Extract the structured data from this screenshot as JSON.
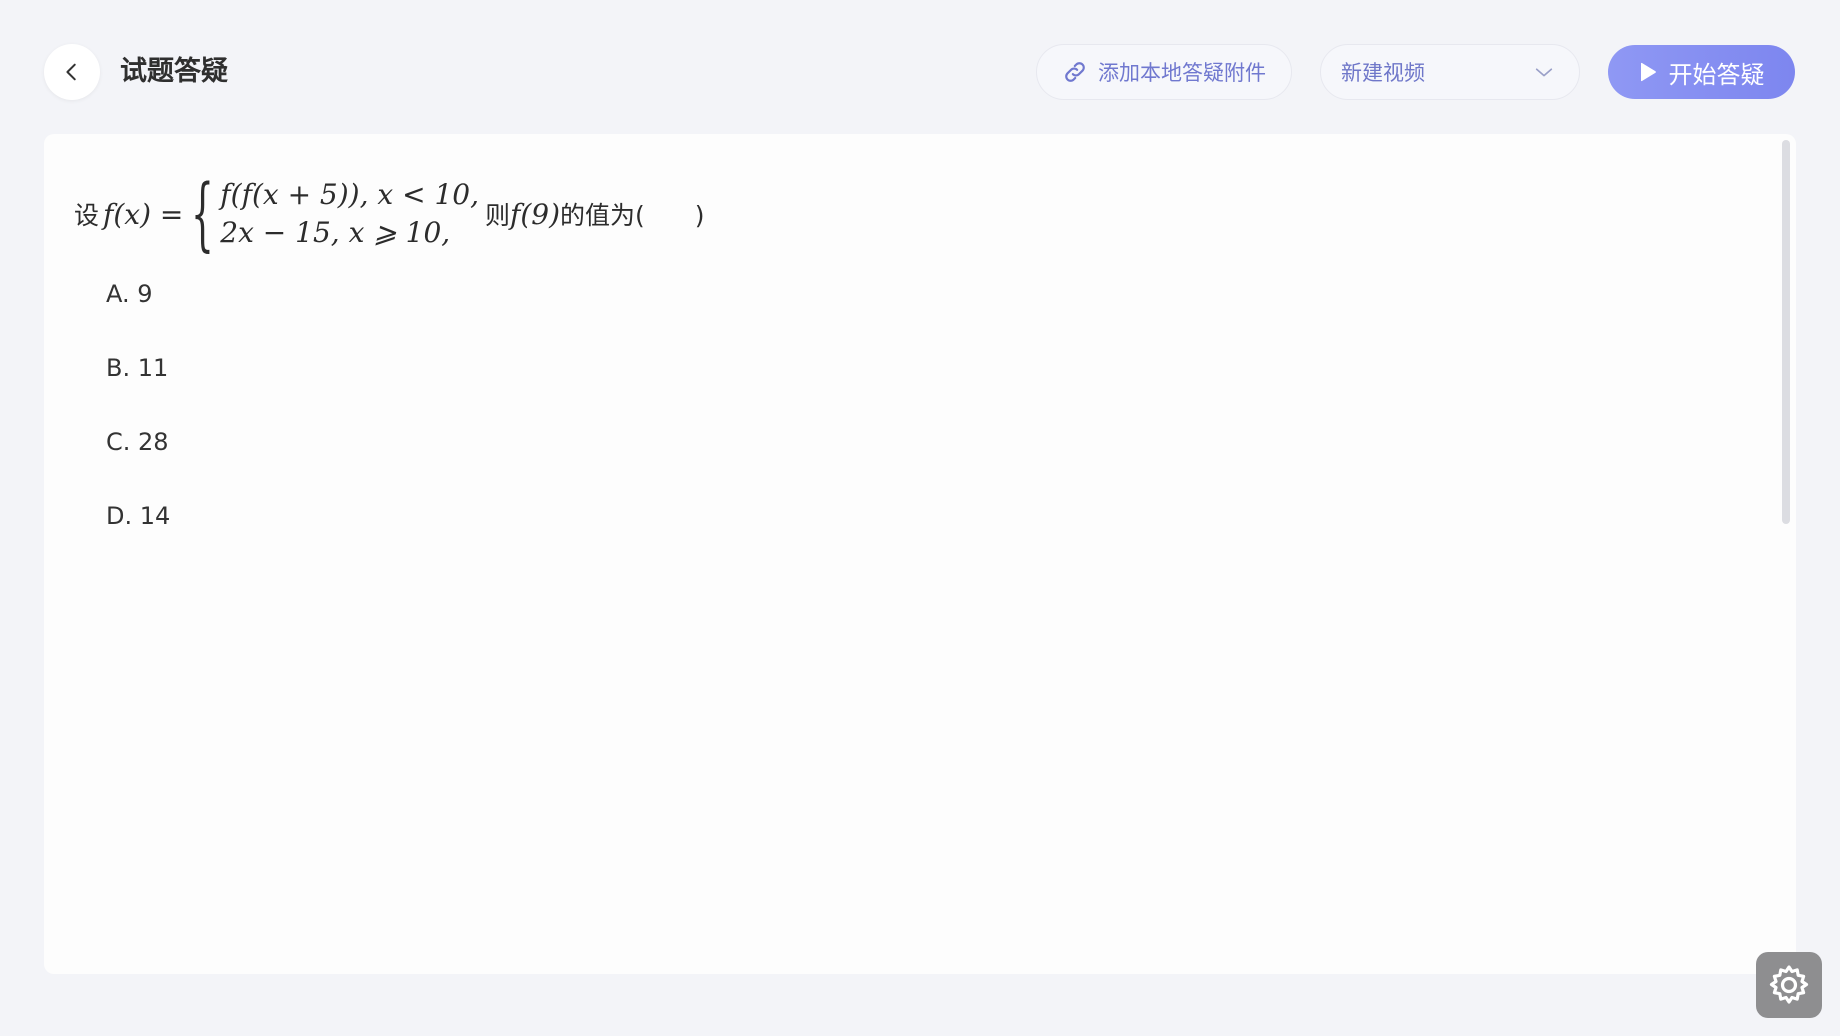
{
  "header": {
    "title": "试题答疑",
    "attach_label": "添加本地答疑附件",
    "video_select_value": "新建视频",
    "start_label": "开始答疑"
  },
  "question": {
    "prefix": "设",
    "fx": "f(x) =",
    "case1": "f(f(x + 5)), x < 10,",
    "case2": "2x − 15, x ⩾ 10,",
    "suffix_text": "则",
    "f9": "f(9)",
    "suffix_tail": "的值为(　　)"
  },
  "options": [
    {
      "label": "A. 9"
    },
    {
      "label": "B. 11"
    },
    {
      "label": "C. 28"
    },
    {
      "label": "D. 14"
    }
  ],
  "colors": {
    "accent": "#7d86ef",
    "link": "#7078cf",
    "background": "#f3f4f8"
  },
  "icons": {
    "back": "chevron-left-icon",
    "attach": "link-icon",
    "dropdown": "chevron-down-icon",
    "start": "play-icon",
    "settings": "gear-icon"
  }
}
